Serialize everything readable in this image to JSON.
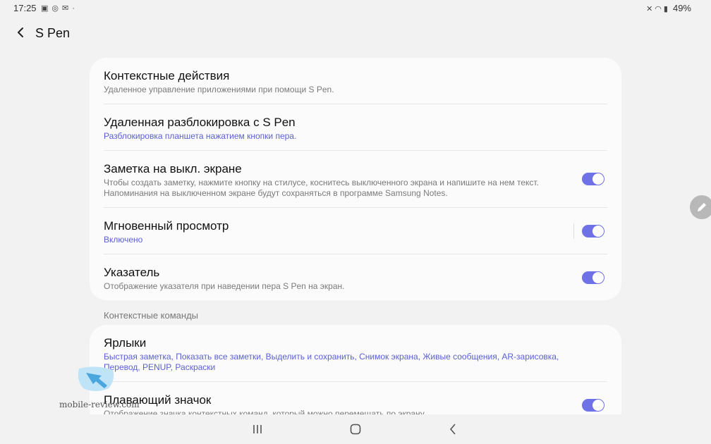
{
  "status_bar": {
    "time": "17:25",
    "left_icons": [
      "gallery-icon",
      "instagram-icon",
      "notification-icon"
    ],
    "battery": "49%",
    "right_icons": [
      "mute-icon",
      "wifi-icon",
      "signal-icon"
    ]
  },
  "header": {
    "title": "S Pen",
    "back_icon": "back-arrow-icon"
  },
  "settings": [
    {
      "title": "Контекстные действия",
      "subtitle": "Удаленное управление приложениями при помощи S Pen."
    },
    {
      "title": "Удаленная разблокировка с S Pen",
      "subtitle": "Разблокировка планшета нажатием кнопки пера."
    },
    {
      "title": "Заметка на выкл. экране",
      "subtitle_line1": "Чтобы создать заметку, нажмите кнопку на стилусе, коснитесь выключенного экрана и напишите на нем текст.",
      "subtitle_line2": "Напоминания на выключенном экране будут сохраняться в программе Samsung Notes.",
      "toggle_on": true
    },
    {
      "title": "Мгновенный просмотр",
      "subtitle": "Включено",
      "toggle_on": true
    },
    {
      "title": "Указатель",
      "subtitle": "Отображение указателя при наведении пера S Pen на экран.",
      "toggle_on": true
    }
  ],
  "section_commands": {
    "header": "Контекстные команды"
  },
  "commands": [
    {
      "title": "Ярлыки",
      "subtitle_line1": "Быстрая заметка, Показать все заметки, Выделить и сохранить, Снимок экрана, Живые сообщения, AR-зарисовка,",
      "subtitle_line2": "Перевод, PENUP, Раскраски"
    },
    {
      "title": "Плавающий значок",
      "subtitle": "Отображение значка контекстных команд, который можно перемещать по экрану.",
      "toggle_on": true
    }
  ],
  "nav_bar": {
    "recents_icon": "recents-icon",
    "home_icon": "home-icon",
    "back_icon": "back-icon"
  },
  "floating_button": {
    "icon": "pen-icon"
  },
  "watermark": {
    "text": "mobile-review.com"
  },
  "colors": {
    "accent": "#5a5fd6",
    "toggle": "#6e72e6",
    "background": "#f2f2f2",
    "card": "#fbfbfb"
  }
}
